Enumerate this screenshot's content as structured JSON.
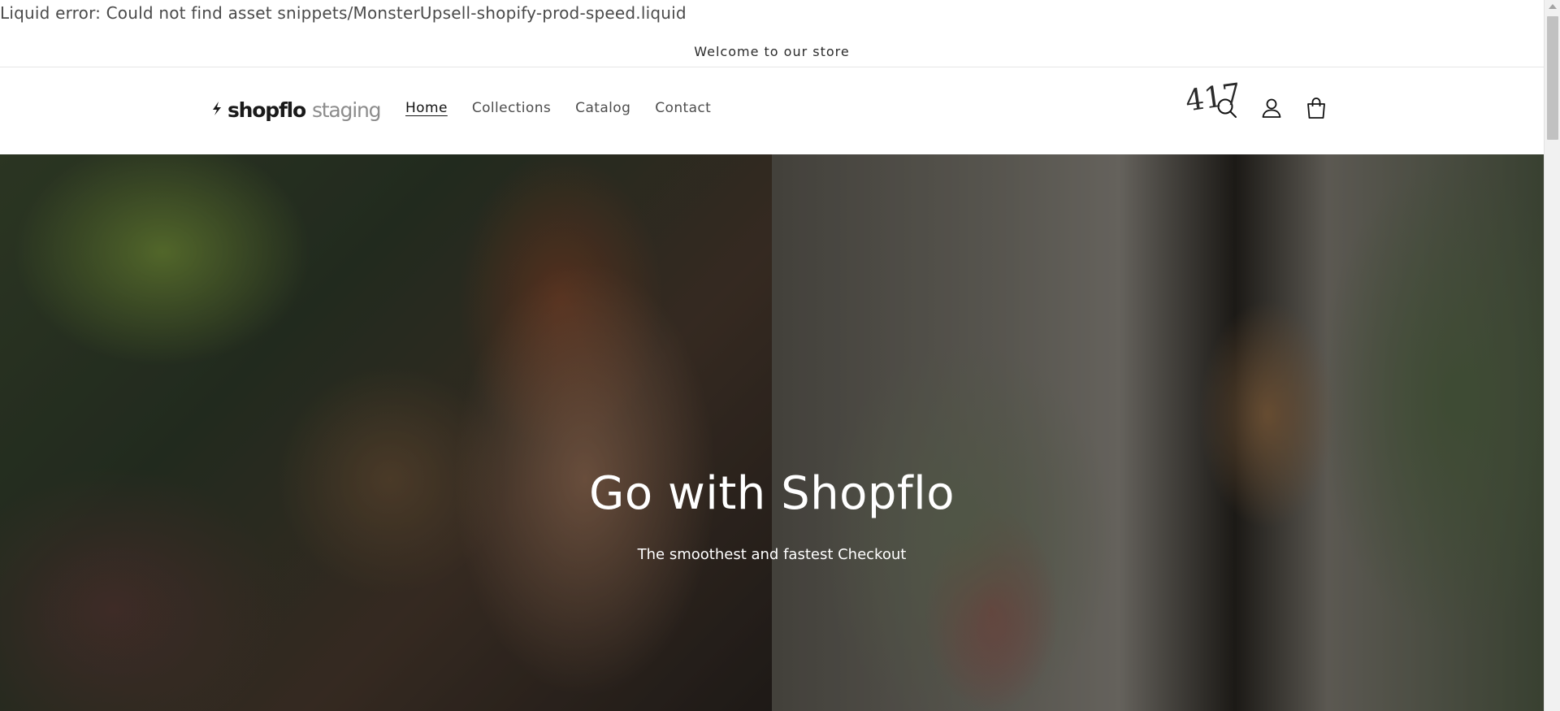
{
  "liquid_error": "Liquid error: Could not find asset snippets/MonsterUpsell-shopify-prod-speed.liquid",
  "announcement": "Welcome to our store",
  "logo": {
    "brand": "shopflo",
    "env": "staging"
  },
  "nav": {
    "items": [
      {
        "label": "Home",
        "active": true
      },
      {
        "label": "Collections",
        "active": false
      },
      {
        "label": "Catalog",
        "active": false
      },
      {
        "label": "Contact",
        "active": false
      }
    ]
  },
  "header_icons": [
    "search-icon",
    "account-icon",
    "cart-icon"
  ],
  "hero": {
    "house_number": "417",
    "title": "Go with Shopflo",
    "subtitle": "The smoothest and fastest Checkout"
  },
  "colors": {
    "text": "#121212",
    "muted": "#4d4d4d",
    "logo_env": "#8c8c8c",
    "hero_text": "#ffffff"
  }
}
